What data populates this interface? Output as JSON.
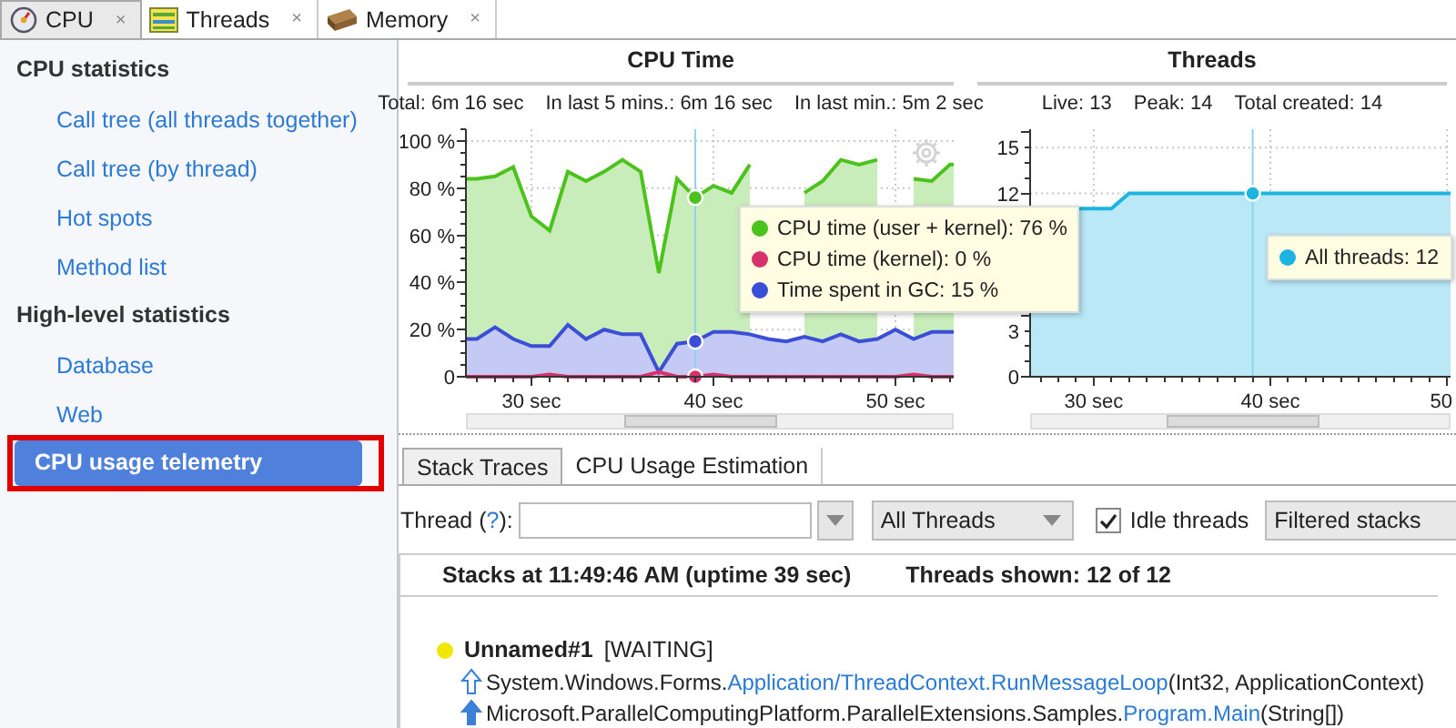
{
  "tabs": [
    {
      "label": "CPU",
      "selected": true,
      "close": "×"
    },
    {
      "label": "Threads",
      "selected": false,
      "close": "×"
    },
    {
      "label": "Memory",
      "selected": false,
      "close": "×"
    }
  ],
  "sidebar": {
    "sections": [
      {
        "title": "CPU statistics",
        "items": [
          {
            "label": "Call tree (all threads together)",
            "selected": false,
            "outlined": false
          },
          {
            "label": "Call tree (by thread)",
            "selected": false,
            "outlined": false
          },
          {
            "label": "Hot spots",
            "selected": false,
            "outlined": false
          },
          {
            "label": "Method list",
            "selected": false,
            "outlined": false
          }
        ]
      },
      {
        "title": "High-level statistics",
        "items": [
          {
            "label": "Database",
            "selected": false,
            "outlined": false
          },
          {
            "label": "Web",
            "selected": false,
            "outlined": false
          },
          {
            "label": "CPU usage telemetry",
            "selected": true,
            "outlined": true
          }
        ]
      }
    ]
  },
  "charts": [
    {
      "summary": [
        "Total: 6m 16 sec",
        "In last 5 mins.: 6m 16 sec",
        "In last min.: 5m 2 sec"
      ],
      "chart_data": {
        "type": "area",
        "title": "CPU Time",
        "x": [
          26.4,
          27,
          28,
          29,
          30,
          31,
          32,
          33,
          34,
          35,
          36,
          37,
          38,
          39,
          40,
          41,
          42,
          43,
          44,
          45,
          46,
          47,
          48,
          49,
          50,
          51,
          52,
          53,
          53.2
        ],
        "series": [
          {
            "name": "CPU time (user + kernel)",
            "color": "#4cc21c",
            "values": [
              84,
              84,
              85,
              89,
              68,
              62,
              87,
              83,
              87,
              92,
              87,
              44,
              84,
              76,
              81,
              78,
              90,
              null,
              null,
              78,
              83,
              92,
              90,
              92,
              null,
              84,
              83,
              90,
              90
            ]
          },
          {
            "name": "CPU time (kernel)",
            "color": "#d6336c",
            "values": [
              0,
              0,
              0,
              0,
              0,
              1,
              0,
              0,
              0,
              0,
              0,
              2,
              0,
              0,
              1,
              0,
              0,
              0,
              0,
              0,
              0,
              0,
              0,
              0,
              0,
              1,
              0,
              0,
              0
            ]
          },
          {
            "name": "Time spent in GC",
            "color": "#3b4fd6",
            "values": [
              16,
              16,
              21,
              16,
              13,
              13,
              22,
              16,
              20,
              18,
              18,
              2,
              14,
              15,
              19,
              19,
              18,
              16,
              15,
              17,
              15,
              18,
              15,
              16,
              20,
              16,
              19,
              19,
              19
            ]
          }
        ],
        "xlim": [
          26.4,
          53.2
        ],
        "ylim": [
          0,
          105
        ],
        "grid": true,
        "xticks": [
          {
            "value": 30,
            "label": "30 sec"
          },
          {
            "value": 40,
            "label": "40 sec"
          },
          {
            "value": 50,
            "label": "50 sec"
          }
        ],
        "yticks": [
          {
            "value": 0,
            "label": "0"
          },
          {
            "value": 20,
            "label": "20 %"
          },
          {
            "value": 40,
            "label": "40 %"
          },
          {
            "value": 60,
            "label": "60 %"
          },
          {
            "value": 80,
            "label": "80 %"
          },
          {
            "value": 100,
            "label": "100 %"
          }
        ],
        "ref_lines": [
          {
            "axis": "x",
            "value": 39
          }
        ]
      },
      "readings": [
        ": 76 %",
        ": 0 %",
        ": 15 %"
      ]
    },
    {
      "summary": [
        "Live: 13",
        "Peak: 14",
        "Total created: 14"
      ],
      "chart_data": {
        "type": "area",
        "title": "Threads",
        "x": [
          26.4,
          27,
          28,
          29,
          30,
          31,
          32,
          33,
          34,
          35,
          36,
          37,
          38,
          39,
          40,
          41,
          42,
          43,
          44,
          45,
          46,
          47,
          48,
          49,
          50,
          50.2
        ],
        "series": [
          {
            "name": "All threads",
            "color": "#1cb4e0",
            "values": [
              11,
              11,
              11,
              11,
              11,
              11,
              12,
              12,
              12,
              12,
              12,
              12,
              12,
              12,
              12,
              12,
              12,
              12,
              12,
              12,
              12,
              12,
              12,
              12,
              12,
              12
            ]
          }
        ],
        "xlim": [
          26.4,
          50.2
        ],
        "ylim": [
          0,
          16.2
        ],
        "grid": true,
        "xticks": [
          {
            "value": 30,
            "label": "30 sec"
          },
          {
            "value": 40,
            "label": "40 sec"
          },
          {
            "value": 50,
            "label": "50"
          }
        ],
        "yticks": [
          {
            "value": 0,
            "label": "0"
          },
          {
            "value": 3,
            "label": "3"
          },
          {
            "value": 12,
            "label": "12"
          },
          {
            "value": 15,
            "label": "15"
          }
        ],
        "ref_lines": [
          {
            "axis": "x",
            "value": 39
          }
        ]
      },
      "readings": [
        ": 12"
      ]
    }
  ],
  "lower": {
    "tabs": [
      {
        "label": "Stack Traces",
        "selected": true
      },
      {
        "label": "CPU Usage Estimation",
        "selected": false
      }
    ],
    "thread_label": {
      "before": "Thread (",
      "link": "?",
      "after": "):"
    },
    "thread_filter": "All Threads",
    "idle_threads": {
      "label": "Idle threads",
      "checked": true
    },
    "stack_filter": "Filtered stacks",
    "header": [
      "Stacks at 11:49:46 AM (uptime 39 sec)",
      "Threads shown: 12 of 12"
    ],
    "threads": [
      {
        "name": "Unnamed#1",
        "state": "[WAITING]",
        "color": "#f0e800",
        "frames": [
          {
            "kind": "outline",
            "prefix": "System.Windows.Forms.",
            "method": "Application/ThreadContext.RunMessageLoop",
            "args": "(Int32, ApplicationContext)"
          },
          {
            "kind": "filled",
            "prefix": "Microsoft.ParallelComputingPlatform.ParallelExtensions.Samples.",
            "method": "Program.Main",
            "args": "(String[])"
          }
        ]
      }
    ]
  }
}
